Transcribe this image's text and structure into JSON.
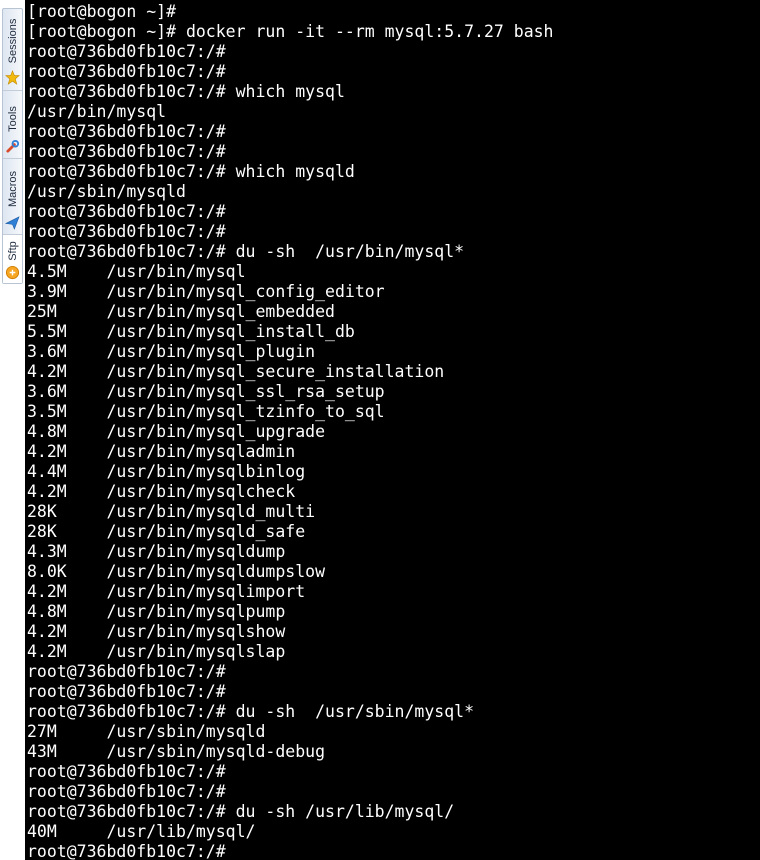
{
  "sidebar": {
    "tabs": [
      {
        "label": "Sessions",
        "icon": "star-icon",
        "color": "#f2b90f"
      },
      {
        "label": "Tools",
        "icon": "tools-icon",
        "color": "#d84a2a"
      },
      {
        "label": "Macros",
        "icon": "send-icon",
        "color": "#2f7fd6"
      },
      {
        "label": "Sftp",
        "icon": "sftp-icon",
        "color": "#f08a00"
      }
    ]
  },
  "terminal": {
    "lines": [
      "[root@bogon ~]#",
      "[root@bogon ~]# docker run -it --rm mysql:5.7.27 bash",
      "root@736bd0fb10c7:/#",
      "root@736bd0fb10c7:/#",
      "root@736bd0fb10c7:/# which mysql",
      "/usr/bin/mysql",
      "root@736bd0fb10c7:/#",
      "root@736bd0fb10c7:/#",
      "root@736bd0fb10c7:/# which mysqld",
      "/usr/sbin/mysqld",
      "root@736bd0fb10c7:/#",
      "root@736bd0fb10c7:/#",
      "root@736bd0fb10c7:/# du -sh  /usr/bin/mysql*",
      "4.5M    /usr/bin/mysql",
      "3.9M    /usr/bin/mysql_config_editor",
      "25M     /usr/bin/mysql_embedded",
      "5.5M    /usr/bin/mysql_install_db",
      "3.6M    /usr/bin/mysql_plugin",
      "4.2M    /usr/bin/mysql_secure_installation",
      "3.6M    /usr/bin/mysql_ssl_rsa_setup",
      "3.5M    /usr/bin/mysql_tzinfo_to_sql",
      "4.8M    /usr/bin/mysql_upgrade",
      "4.2M    /usr/bin/mysqladmin",
      "4.4M    /usr/bin/mysqlbinlog",
      "4.2M    /usr/bin/mysqlcheck",
      "28K     /usr/bin/mysqld_multi",
      "28K     /usr/bin/mysqld_safe",
      "4.3M    /usr/bin/mysqldump",
      "8.0K    /usr/bin/mysqldumpslow",
      "4.2M    /usr/bin/mysqlimport",
      "4.8M    /usr/bin/mysqlpump",
      "4.2M    /usr/bin/mysqlshow",
      "4.2M    /usr/bin/mysqlslap",
      "root@736bd0fb10c7:/#",
      "root@736bd0fb10c7:/#",
      "root@736bd0fb10c7:/# du -sh  /usr/sbin/mysql*",
      "27M     /usr/sbin/mysqld",
      "43M     /usr/sbin/mysqld-debug",
      "root@736bd0fb10c7:/#",
      "root@736bd0fb10c7:/#",
      "root@736bd0fb10c7:/# du -sh /usr/lib/mysql/",
      "40M     /usr/lib/mysql/",
      "root@736bd0fb10c7:/#"
    ],
    "background": "#000000",
    "foreground": "#ffffff"
  }
}
